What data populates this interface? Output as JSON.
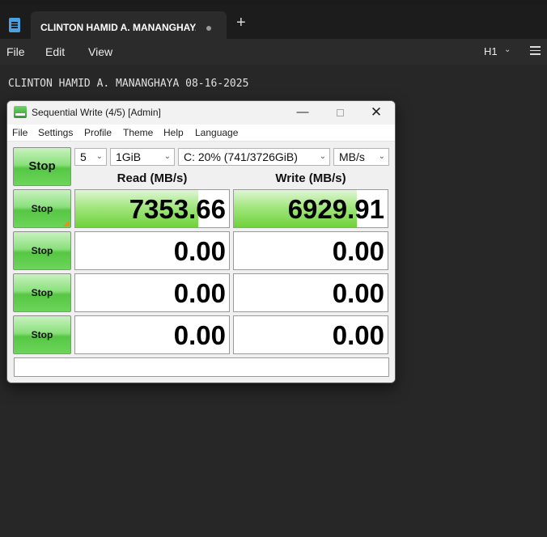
{
  "notepad": {
    "tab_title": "CLINTON HAMID A. MANANGHAYA",
    "new_tab": "+",
    "menu": [
      "File",
      "Edit",
      "View"
    ],
    "heading_level": "H1",
    "content_line": "CLINTON HAMID A. MANANGHAYA 08-16-2025"
  },
  "cdm": {
    "title": "Sequential Write (4/5) [Admin]",
    "window_buttons": {
      "minimize": "—",
      "close": "✕"
    },
    "menu": [
      "File",
      "Settings",
      "Profile",
      "Theme",
      "Help",
      "Language"
    ],
    "all_button": "Stop",
    "count": "5",
    "size": "1GiB",
    "drive": "C: 20% (741/3726GiB)",
    "unit": "MB/s",
    "read_header": "Read (MB/s)",
    "write_header": "Write (MB/s)",
    "rows": [
      {
        "button": "Stop",
        "read": "7353.66",
        "write": "6929.91",
        "read_fill": 0.8,
        "write_fill": 0.8
      },
      {
        "button": "Stop",
        "read": "0.00",
        "write": "0.00",
        "read_fill": 0,
        "write_fill": 0
      },
      {
        "button": "Stop",
        "read": "0.00",
        "write": "0.00",
        "read_fill": 0,
        "write_fill": 0
      },
      {
        "button": "Stop",
        "read": "0.00",
        "write": "0.00",
        "read_fill": 0,
        "write_fill": 0
      }
    ],
    "comment": ""
  },
  "colors": {
    "accent_green": "#6fd23b",
    "progress_marker": "#f08a1a"
  }
}
